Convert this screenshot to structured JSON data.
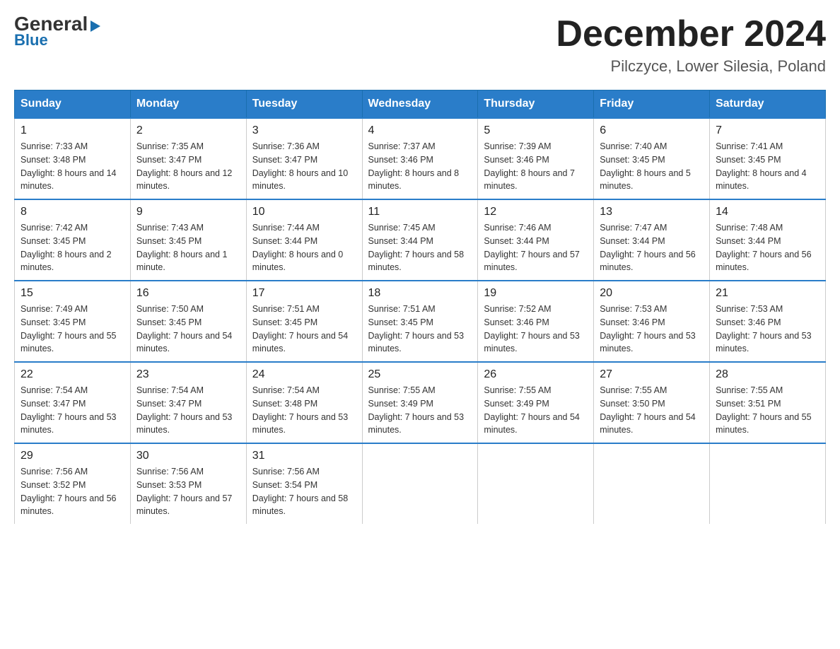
{
  "logo": {
    "general": "General",
    "triangle": "▶",
    "blue": "Blue"
  },
  "title": "December 2024",
  "location": "Pilczyce, Lower Silesia, Poland",
  "days_of_week": [
    "Sunday",
    "Monday",
    "Tuesday",
    "Wednesday",
    "Thursday",
    "Friday",
    "Saturday"
  ],
  "weeks": [
    [
      {
        "day": "1",
        "sunrise": "7:33 AM",
        "sunset": "3:48 PM",
        "daylight": "8 hours and 14 minutes."
      },
      {
        "day": "2",
        "sunrise": "7:35 AM",
        "sunset": "3:47 PM",
        "daylight": "8 hours and 12 minutes."
      },
      {
        "day": "3",
        "sunrise": "7:36 AM",
        "sunset": "3:47 PM",
        "daylight": "8 hours and 10 minutes."
      },
      {
        "day": "4",
        "sunrise": "7:37 AM",
        "sunset": "3:46 PM",
        "daylight": "8 hours and 8 minutes."
      },
      {
        "day": "5",
        "sunrise": "7:39 AM",
        "sunset": "3:46 PM",
        "daylight": "8 hours and 7 minutes."
      },
      {
        "day": "6",
        "sunrise": "7:40 AM",
        "sunset": "3:45 PM",
        "daylight": "8 hours and 5 minutes."
      },
      {
        "day": "7",
        "sunrise": "7:41 AM",
        "sunset": "3:45 PM",
        "daylight": "8 hours and 4 minutes."
      }
    ],
    [
      {
        "day": "8",
        "sunrise": "7:42 AM",
        "sunset": "3:45 PM",
        "daylight": "8 hours and 2 minutes."
      },
      {
        "day": "9",
        "sunrise": "7:43 AM",
        "sunset": "3:45 PM",
        "daylight": "8 hours and 1 minute."
      },
      {
        "day": "10",
        "sunrise": "7:44 AM",
        "sunset": "3:44 PM",
        "daylight": "8 hours and 0 minutes."
      },
      {
        "day": "11",
        "sunrise": "7:45 AM",
        "sunset": "3:44 PM",
        "daylight": "7 hours and 58 minutes."
      },
      {
        "day": "12",
        "sunrise": "7:46 AM",
        "sunset": "3:44 PM",
        "daylight": "7 hours and 57 minutes."
      },
      {
        "day": "13",
        "sunrise": "7:47 AM",
        "sunset": "3:44 PM",
        "daylight": "7 hours and 56 minutes."
      },
      {
        "day": "14",
        "sunrise": "7:48 AM",
        "sunset": "3:44 PM",
        "daylight": "7 hours and 56 minutes."
      }
    ],
    [
      {
        "day": "15",
        "sunrise": "7:49 AM",
        "sunset": "3:45 PM",
        "daylight": "7 hours and 55 minutes."
      },
      {
        "day": "16",
        "sunrise": "7:50 AM",
        "sunset": "3:45 PM",
        "daylight": "7 hours and 54 minutes."
      },
      {
        "day": "17",
        "sunrise": "7:51 AM",
        "sunset": "3:45 PM",
        "daylight": "7 hours and 54 minutes."
      },
      {
        "day": "18",
        "sunrise": "7:51 AM",
        "sunset": "3:45 PM",
        "daylight": "7 hours and 53 minutes."
      },
      {
        "day": "19",
        "sunrise": "7:52 AM",
        "sunset": "3:46 PM",
        "daylight": "7 hours and 53 minutes."
      },
      {
        "day": "20",
        "sunrise": "7:53 AM",
        "sunset": "3:46 PM",
        "daylight": "7 hours and 53 minutes."
      },
      {
        "day": "21",
        "sunrise": "7:53 AM",
        "sunset": "3:46 PM",
        "daylight": "7 hours and 53 minutes."
      }
    ],
    [
      {
        "day": "22",
        "sunrise": "7:54 AM",
        "sunset": "3:47 PM",
        "daylight": "7 hours and 53 minutes."
      },
      {
        "day": "23",
        "sunrise": "7:54 AM",
        "sunset": "3:47 PM",
        "daylight": "7 hours and 53 minutes."
      },
      {
        "day": "24",
        "sunrise": "7:54 AM",
        "sunset": "3:48 PM",
        "daylight": "7 hours and 53 minutes."
      },
      {
        "day": "25",
        "sunrise": "7:55 AM",
        "sunset": "3:49 PM",
        "daylight": "7 hours and 53 minutes."
      },
      {
        "day": "26",
        "sunrise": "7:55 AM",
        "sunset": "3:49 PM",
        "daylight": "7 hours and 54 minutes."
      },
      {
        "day": "27",
        "sunrise": "7:55 AM",
        "sunset": "3:50 PM",
        "daylight": "7 hours and 54 minutes."
      },
      {
        "day": "28",
        "sunrise": "7:55 AM",
        "sunset": "3:51 PM",
        "daylight": "7 hours and 55 minutes."
      }
    ],
    [
      {
        "day": "29",
        "sunrise": "7:56 AM",
        "sunset": "3:52 PM",
        "daylight": "7 hours and 56 minutes."
      },
      {
        "day": "30",
        "sunrise": "7:56 AM",
        "sunset": "3:53 PM",
        "daylight": "7 hours and 57 minutes."
      },
      {
        "day": "31",
        "sunrise": "7:56 AM",
        "sunset": "3:54 PM",
        "daylight": "7 hours and 58 minutes."
      },
      null,
      null,
      null,
      null
    ]
  ],
  "labels": {
    "sunrise": "Sunrise:",
    "sunset": "Sunset:",
    "daylight": "Daylight:"
  }
}
